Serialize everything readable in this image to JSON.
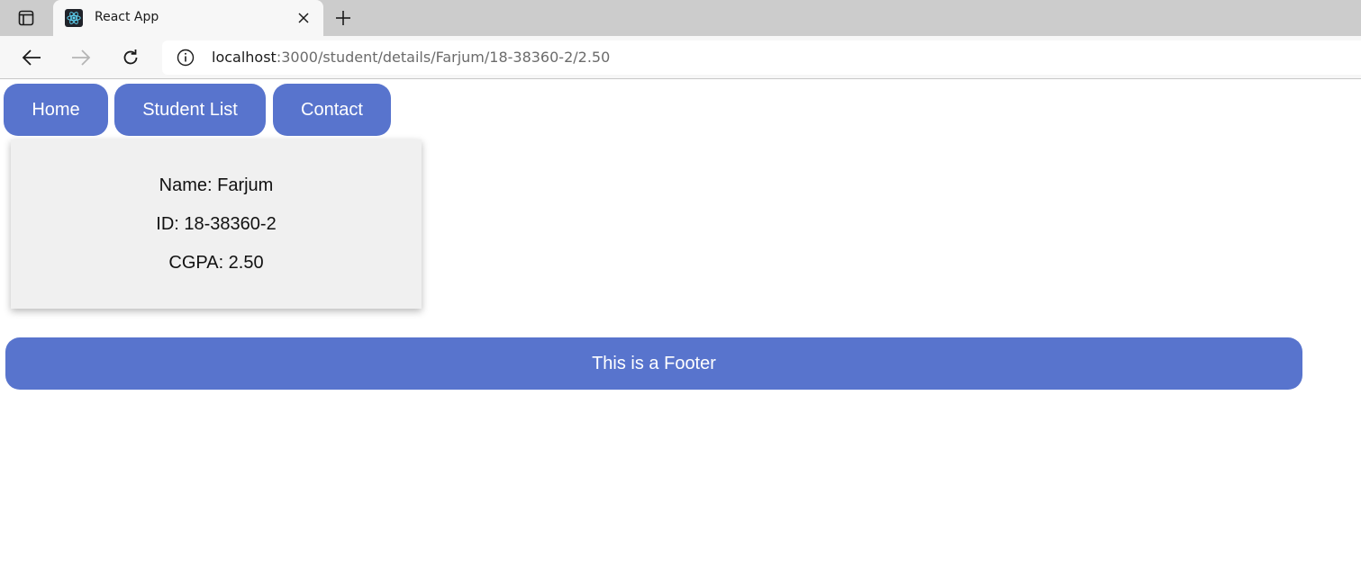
{
  "browser": {
    "tab_title": "React App",
    "url_host": "localhost",
    "url_path": ":3000/student/details/Farjum/18-38360-2/2.50",
    "icons": {
      "tab_actions": "tab-actions-icon",
      "favicon": "react-logo-icon",
      "close": "close-icon",
      "new_tab": "plus-icon",
      "back": "back-arrow-icon",
      "forward": "forward-arrow-icon",
      "reload": "reload-icon",
      "site_info": "info-icon"
    }
  },
  "nav": {
    "items": [
      {
        "label": "Home"
      },
      {
        "label": "Student List"
      },
      {
        "label": "Contact"
      }
    ]
  },
  "student": {
    "name_line": "Name: Farjum",
    "id_line": "ID: 18-38360-2",
    "cgpa_line": "CGPA: 2.50"
  },
  "footer": {
    "text": "This is a Footer"
  },
  "colors": {
    "accent": "#5874cd",
    "card_bg": "#f0f0f0",
    "tabstrip_bg": "#cccccc"
  }
}
